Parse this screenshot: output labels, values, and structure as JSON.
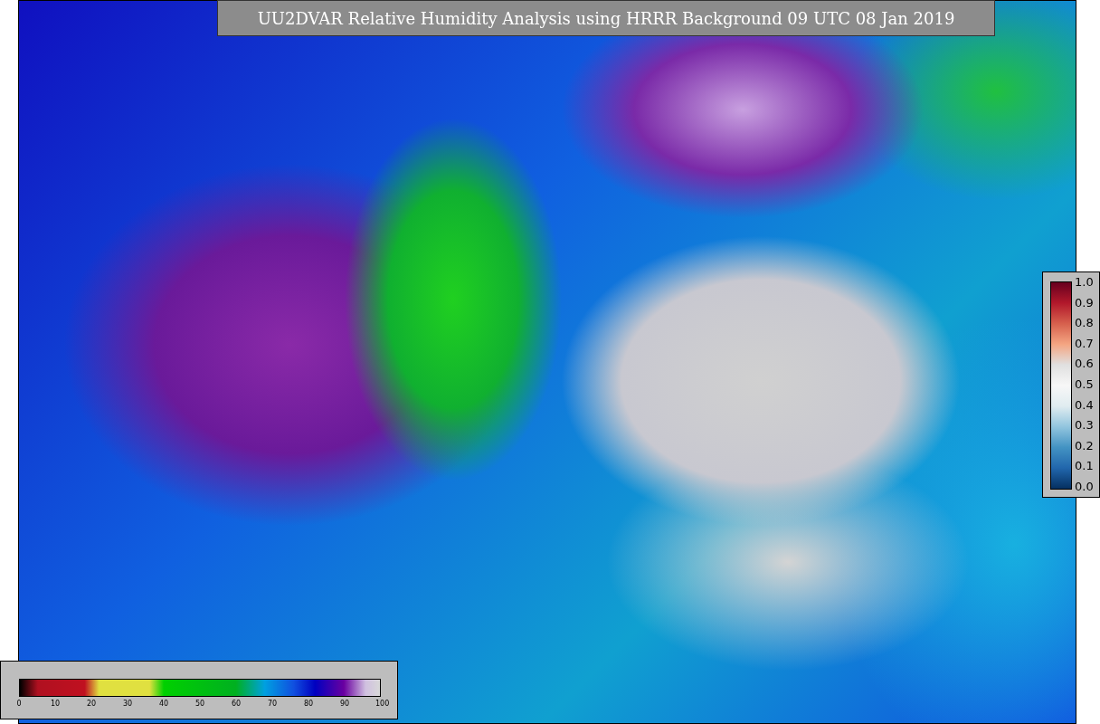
{
  "title": "UU2DVAR Relative Humidity Analysis using HRRR Background 09 UTC 08 Jan 2019",
  "humidity_colorbar": {
    "ticks": [
      "0",
      "10",
      "20",
      "30",
      "40",
      "50",
      "60",
      "70",
      "80",
      "90",
      "100"
    ]
  },
  "observation_colorbar": {
    "ticks": [
      "1.0",
      "0.9",
      "0.8",
      "0.7",
      "0.6",
      "0.5",
      "0.4",
      "0.3",
      "0.2",
      "0.1",
      "0.0"
    ]
  }
}
